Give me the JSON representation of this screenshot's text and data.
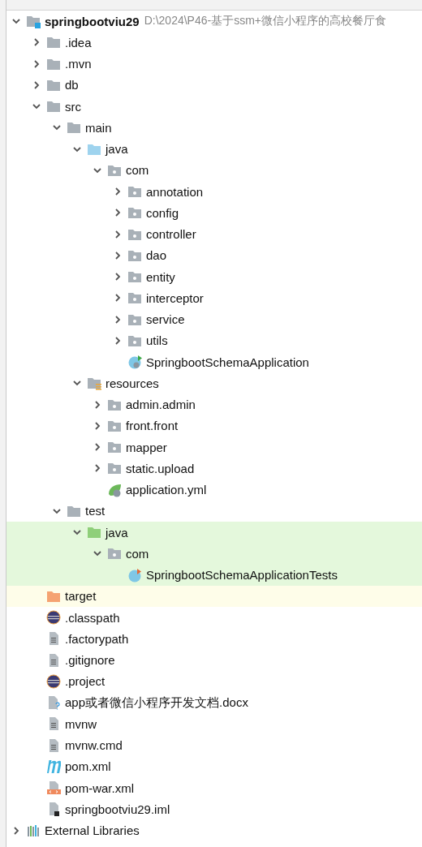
{
  "tree": [
    {
      "label": "springbootviu29",
      "path": "D:\\2024\\P46-基于ssm+微信小程序的高校餐厅食",
      "kind": "module",
      "expanded": true,
      "children": [
        {
          "label": ".idea",
          "kind": "folder",
          "expanded": false
        },
        {
          "label": ".mvn",
          "kind": "folder",
          "expanded": false
        },
        {
          "label": "db",
          "kind": "folder",
          "expanded": false
        },
        {
          "label": "src",
          "kind": "folder",
          "expanded": true,
          "children": [
            {
              "label": "main",
              "kind": "folder",
              "expanded": true,
              "children": [
                {
                  "label": "java",
                  "kind": "source-folder",
                  "expanded": true,
                  "children": [
                    {
                      "label": "com",
                      "kind": "package",
                      "expanded": true,
                      "children": [
                        {
                          "label": "annotation",
                          "kind": "package",
                          "expanded": false
                        },
                        {
                          "label": "config",
                          "kind": "package",
                          "expanded": false
                        },
                        {
                          "label": "controller",
                          "kind": "package",
                          "expanded": false
                        },
                        {
                          "label": "dao",
                          "kind": "package",
                          "expanded": false
                        },
                        {
                          "label": "entity",
                          "kind": "package",
                          "expanded": false
                        },
                        {
                          "label": "interceptor",
                          "kind": "package",
                          "expanded": false
                        },
                        {
                          "label": "service",
                          "kind": "package",
                          "expanded": false
                        },
                        {
                          "label": "utils",
                          "kind": "package",
                          "expanded": false
                        },
                        {
                          "label": "SpringbootSchemaApplication",
                          "kind": "spring-class"
                        }
                      ]
                    }
                  ]
                },
                {
                  "label": "resources",
                  "kind": "resources-folder",
                  "expanded": true,
                  "children": [
                    {
                      "label": "admin.admin",
                      "kind": "package",
                      "expanded": false
                    },
                    {
                      "label": "front.front",
                      "kind": "package",
                      "expanded": false
                    },
                    {
                      "label": "mapper",
                      "kind": "package",
                      "expanded": false
                    },
                    {
                      "label": "static.upload",
                      "kind": "package",
                      "expanded": false
                    },
                    {
                      "label": "application.yml",
                      "kind": "spring-config"
                    }
                  ]
                }
              ]
            },
            {
              "label": "test",
              "kind": "folder",
              "expanded": true,
              "children": [
                {
                  "label": "java",
                  "kind": "test-folder",
                  "expanded": true,
                  "test_scope": true,
                  "children": [
                    {
                      "label": "com",
                      "kind": "package",
                      "expanded": true,
                      "test_scope": true,
                      "children": [
                        {
                          "label": "SpringbootSchemaApplicationTests",
                          "kind": "test-class",
                          "test_scope": true
                        }
                      ]
                    }
                  ]
                }
              ]
            }
          ]
        },
        {
          "label": "target",
          "kind": "excluded-folder",
          "excluded": true
        },
        {
          "label": ".classpath",
          "kind": "eclipse"
        },
        {
          "label": ".factorypath",
          "kind": "text-file"
        },
        {
          "label": ".gitignore",
          "kind": "text-file"
        },
        {
          "label": ".project",
          "kind": "eclipse"
        },
        {
          "label": "app或者微信小程序开发文档.docx",
          "kind": "unknown-file"
        },
        {
          "label": "mvnw",
          "kind": "text-file"
        },
        {
          "label": "mvnw.cmd",
          "kind": "text-file"
        },
        {
          "label": "pom.xml",
          "kind": "maven"
        },
        {
          "label": "pom-war.xml",
          "kind": "xml-file"
        },
        {
          "label": "springbootviu29.iml",
          "kind": "iml-file"
        }
      ]
    },
    {
      "label": "External Libraries",
      "kind": "libraries",
      "expanded": false
    }
  ]
}
